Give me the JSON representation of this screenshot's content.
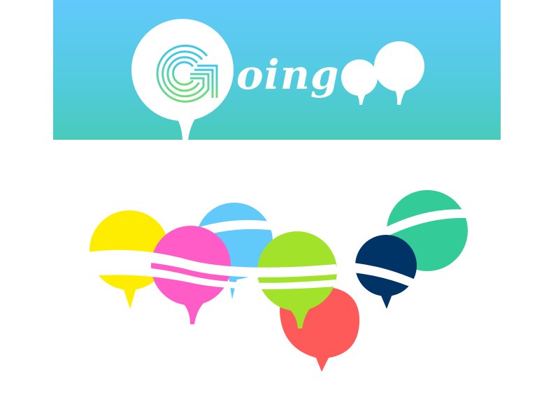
{
  "logo": {
    "initial": "G",
    "word": "oing"
  },
  "colors": {
    "banner_top": "#62c9fb",
    "banner_bottom": "#48cbbb",
    "yellow": "#ffed00",
    "pink": "#ff5cc8",
    "sky": "#62c9fb",
    "lime": "#a3e22a",
    "coral": "#ff5a5a",
    "mint": "#33cc99",
    "navy": "#003366"
  }
}
